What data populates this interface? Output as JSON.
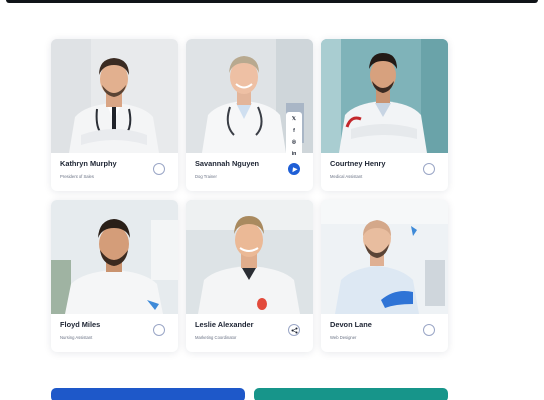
{
  "team": [
    {
      "name": "Kathryn Murphy",
      "role": "President of Sales",
      "share_state": "default"
    },
    {
      "name": "Savannah Nguyen",
      "role": "Dog Trainer",
      "share_state": "active"
    },
    {
      "name": "Courtney Henry",
      "role": "Medical Assistant",
      "share_state": "default"
    },
    {
      "name": "Floyd Miles",
      "role": "Nursing Assistant",
      "share_state": "default"
    },
    {
      "name": "Leslie Alexander",
      "role": "Marketing Coordinator",
      "share_state": "share"
    },
    {
      "name": " Devon Lane",
      "role": "Web Designer",
      "share_state": "default"
    }
  ],
  "social_icons": [
    "x-icon",
    "facebook-icon",
    "instagram-icon",
    "linkedin-icon"
  ],
  "social_glyphs": [
    "𝕏",
    "f",
    "◎",
    "in"
  ],
  "colors": {
    "accent_blue": "#1e58c9",
    "accent_teal": "#17958a",
    "active_share": "#1f5fd6"
  },
  "buttons": [
    {
      "label": ""
    },
    {
      "label": ""
    }
  ]
}
